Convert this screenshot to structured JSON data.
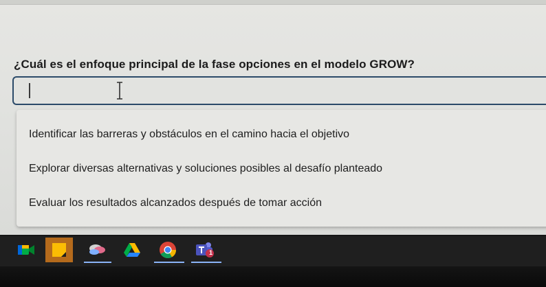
{
  "question": {
    "text": "¿Cuál es el enfoque principal de la fase opciones en el modelo GROW?"
  },
  "answer_input": {
    "value": ""
  },
  "options": [
    {
      "label": "Identificar las barreras y obstáculos en el camino hacia el objetivo"
    },
    {
      "label": "Explorar diversas alternativas y soluciones posibles al desafío planteado"
    },
    {
      "label": "Evaluar los resultados alcanzados después de tomar acción"
    }
  ],
  "shelf": {
    "apps": [
      {
        "icon": "google-meet-icon"
      },
      {
        "icon": "google-keep-icon",
        "active": true
      },
      {
        "icon": "blossom-app-icon"
      },
      {
        "icon": "google-drive-icon"
      },
      {
        "icon": "chrome-icon"
      },
      {
        "icon": "microsoft-teams-icon",
        "badge": "1"
      }
    ]
  }
}
